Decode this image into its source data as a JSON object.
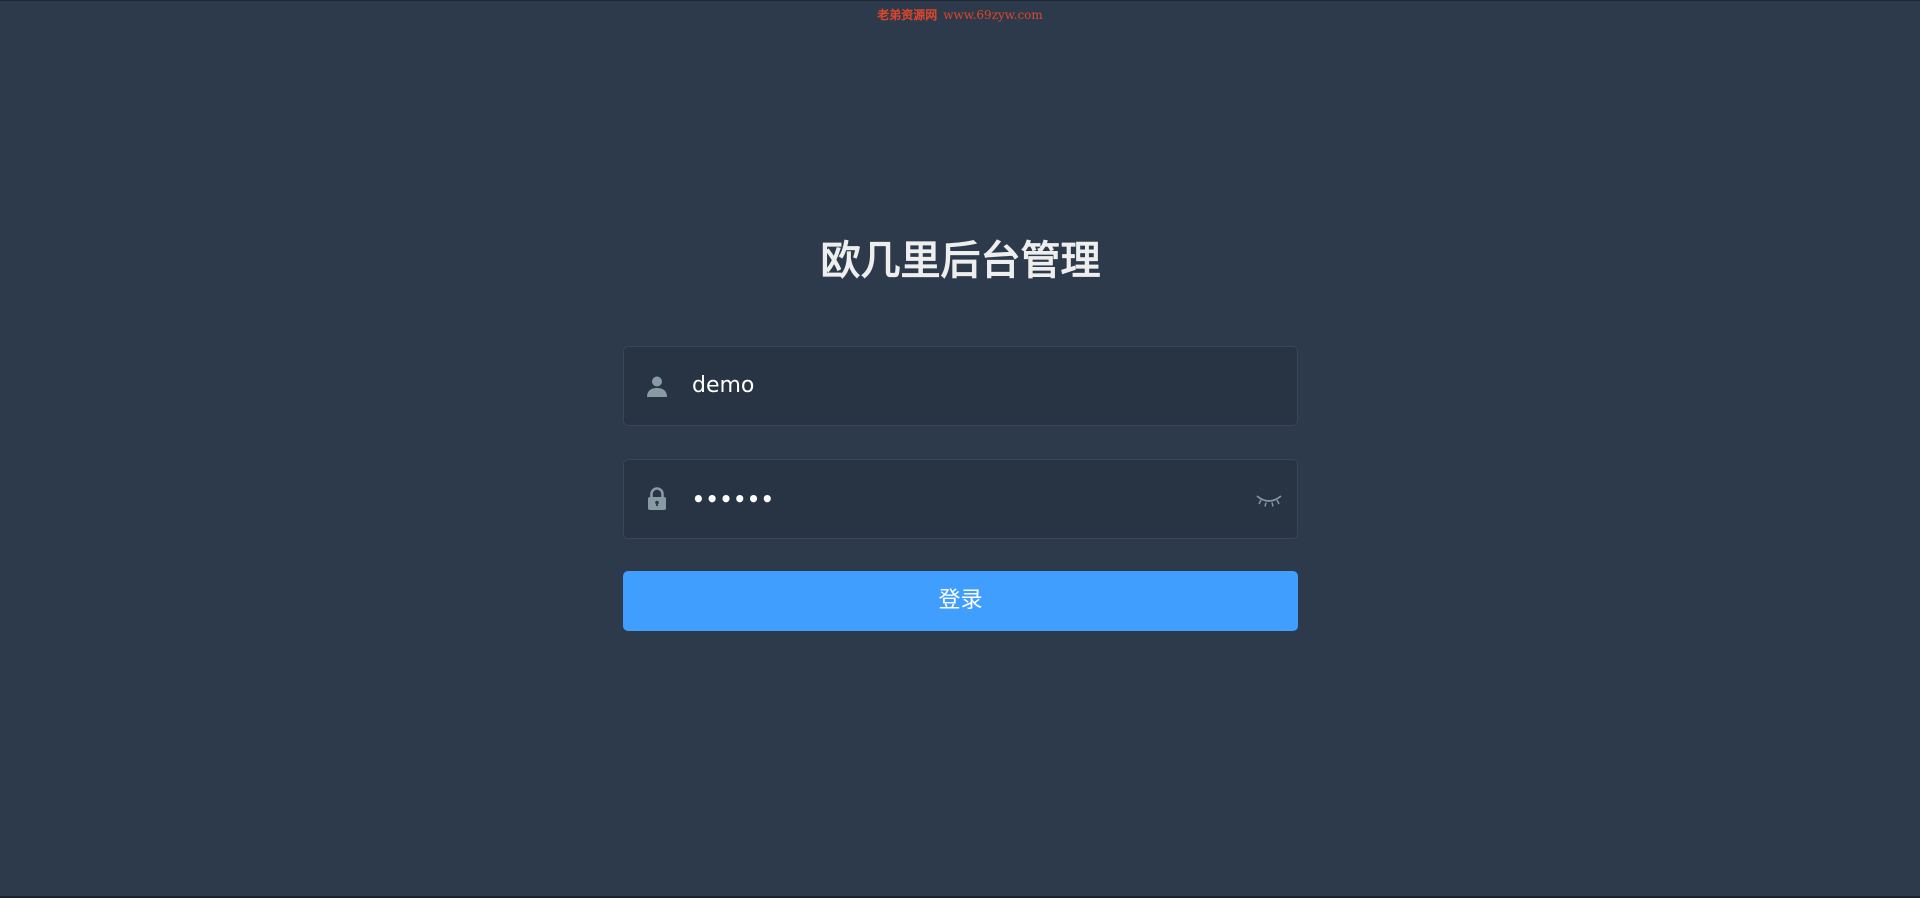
{
  "watermark": {
    "name": "老弟资源网",
    "url": "www.69zyw.com"
  },
  "login": {
    "title": "欧几里后台管理",
    "username": {
      "value": "demo",
      "icon": "user-icon"
    },
    "password": {
      "masked_value": "••••••",
      "icon": "lock-icon",
      "toggle_icon": "eye-closed-icon"
    },
    "submit_label": "登录"
  },
  "colors": {
    "background": "#2d3a4b",
    "input_background": "#283443",
    "input_border": "#3a4656",
    "button": "#409eff",
    "title": "#eeeeee",
    "icon": "#889aa4",
    "watermark": "#e0452a"
  }
}
